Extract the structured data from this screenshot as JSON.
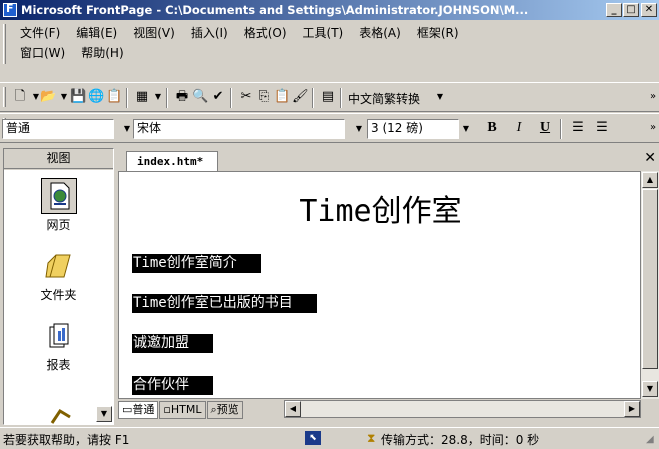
{
  "window": {
    "title": "Microsoft FrontPage - C:\\Documents and Settings\\Administrator.JOHNSON\\M..."
  },
  "menu": {
    "row1": [
      "文件(F)",
      "编辑(E)",
      "视图(V)",
      "插入(I)",
      "格式(O)",
      "工具(T)",
      "表格(A)",
      "框架(R)"
    ],
    "row2": [
      "窗口(W)",
      "帮助(H)"
    ]
  },
  "toolbar": {
    "chinese_convert": "中文简繁转换",
    "style_combo": "普通",
    "font_combo": "宋体",
    "size_combo": "3  (12 磅)",
    "bold": "B",
    "italic": "I",
    "underline": "U"
  },
  "views": {
    "header": "视图",
    "items": [
      "网页",
      "文件夹",
      "报表"
    ]
  },
  "editor": {
    "tab_label": "index.htm*",
    "heading": "Time创作室",
    "links": [
      "Time创作室简介",
      "Time创作室已出版的书目",
      "诚邀加盟",
      "合作伙伴"
    ],
    "bottom_tabs": [
      "普通",
      "HTML",
      "预览"
    ]
  },
  "statusbar": {
    "help": "若要获取帮助，请按 F1",
    "transfer": "传输方式：28.8，时间：0 秒"
  }
}
